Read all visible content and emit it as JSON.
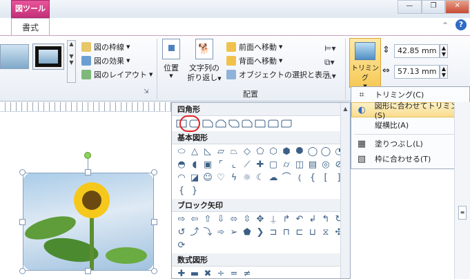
{
  "titlebar": {
    "context_tab": "図ツール",
    "tab": "書式"
  },
  "ribbon": {
    "picture_styles": {
      "border_label": "図の枠線",
      "effects_label": "図の効果",
      "layout_label": "図のレイアウト"
    },
    "arrange": {
      "position_label": "位置",
      "wrap_label_1": "文字列の",
      "wrap_label_2": "折り返し",
      "bring_forward_label": "前面へ移動",
      "send_backward_label": "背面へ移動",
      "selection_label": "オブジェクトの選択と表示",
      "group_label": "配置"
    },
    "size": {
      "trim_label": "トリミング",
      "height_value": "42.85 mm",
      "width_value": "57.13 mm"
    }
  },
  "gallery": {
    "section_rect": "四角形",
    "section_basic": "基本図形",
    "section_arrows": "ブロック矢印",
    "section_math": "数式図形"
  },
  "trim_menu": {
    "items": [
      {
        "label": "トリミング(C)",
        "icon": "crop-icon"
      },
      {
        "label": "図形に合わせてトリミング(S)",
        "icon": "crop-to-shape-icon"
      },
      {
        "label": "縦横比(A)",
        "icon": ""
      },
      {
        "label": "塗りつぶし(L)",
        "icon": "fill-icon"
      },
      {
        "label": "枠に合わせる(T)",
        "icon": "fit-icon"
      }
    ]
  },
  "colors": {
    "accent": "#c4307a",
    "highlight": "#f9dd8d"
  }
}
